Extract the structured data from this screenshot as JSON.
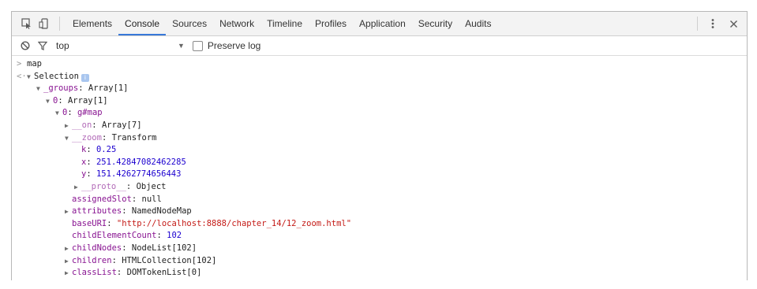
{
  "tabs": [
    "Elements",
    "Console",
    "Sources",
    "Network",
    "Timeline",
    "Profiles",
    "Application",
    "Security",
    "Audits"
  ],
  "toolbar": {
    "context": "top",
    "preserve_log": "Preserve log"
  },
  "console": {
    "input": "map",
    "selection": "Selection",
    "groups_key": "_groups",
    "groups_val": "Array[1]",
    "g0_key": "0",
    "g0_val": "Array[1]",
    "n0_key": "0",
    "n0_val": "g#map",
    "on_key": "__on",
    "on_val": "Array[7]",
    "zoom_key": "__zoom",
    "zoom_val": "Transform",
    "k_key": "k",
    "k_val": "0.25",
    "x_key": "x",
    "x_val": "251.42847082462285",
    "y_key": "y",
    "y_val": "151.4262774656443",
    "proto_key": "__proto__",
    "proto_val": "Object",
    "slot_key": "assignedSlot",
    "slot_val": "null",
    "attr_key": "attributes",
    "attr_val": "NamedNodeMap",
    "uri_key": "baseURI",
    "uri_val": "\"http://localhost:8888/chapter_14/12_zoom.html\"",
    "cec_key": "childElementCount",
    "cec_val": "102",
    "cn_key": "childNodes",
    "cn_val": "NodeList[102]",
    "ch_key": "children",
    "ch_val": "HTMLCollection[102]",
    "cl_key": "classList",
    "cl_val": "DOMTokenList[0]"
  }
}
